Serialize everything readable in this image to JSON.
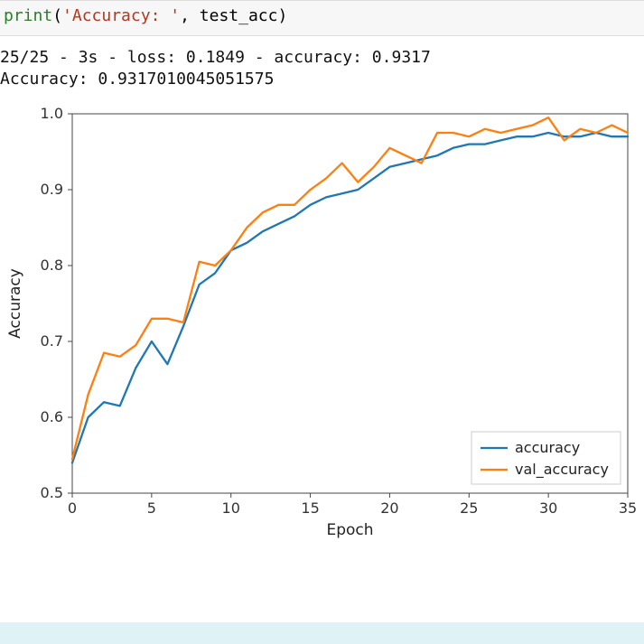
{
  "code": {
    "fn": "print",
    "lparen": "(",
    "str_lit": "'Accuracy: '",
    "comma_sp": ", ",
    "arg": "test_acc",
    "rparen": ")"
  },
  "output": {
    "line1": "25/25 - 3s - loss: 0.1849 - accuracy: 0.9317",
    "line2": "Accuracy:  0.9317010045051575"
  },
  "chart_data": {
    "type": "line",
    "xlabel": "Epoch",
    "ylabel": "Accuracy",
    "xlim": [
      0,
      35
    ],
    "ylim": [
      0.5,
      1.0
    ],
    "xticks": [
      0,
      5,
      10,
      15,
      20,
      25,
      30,
      35
    ],
    "yticks": [
      0.5,
      0.6,
      0.7,
      0.8,
      0.9,
      1.0
    ],
    "x": [
      0,
      1,
      2,
      3,
      4,
      5,
      6,
      7,
      8,
      9,
      10,
      11,
      12,
      13,
      14,
      15,
      16,
      17,
      18,
      19,
      20,
      21,
      22,
      23,
      24,
      25,
      26,
      27,
      28,
      29,
      30,
      31,
      32,
      33,
      34,
      35
    ],
    "series": [
      {
        "name": "accuracy",
        "color": "#1f77b4",
        "values": [
          0.54,
          0.6,
          0.62,
          0.615,
          0.665,
          0.7,
          0.67,
          0.72,
          0.775,
          0.79,
          0.82,
          0.83,
          0.845,
          0.855,
          0.865,
          0.88,
          0.89,
          0.895,
          0.9,
          0.915,
          0.93,
          0.935,
          0.94,
          0.945,
          0.955,
          0.96,
          0.96,
          0.965,
          0.97,
          0.97,
          0.975,
          0.97,
          0.97,
          0.975,
          0.97,
          0.97
        ]
      },
      {
        "name": "val_accuracy",
        "color": "#ff7f0e",
        "values": [
          0.545,
          0.63,
          0.685,
          0.68,
          0.695,
          0.73,
          0.73,
          0.725,
          0.805,
          0.8,
          0.82,
          0.85,
          0.87,
          0.88,
          0.88,
          0.9,
          0.915,
          0.935,
          0.91,
          0.93,
          0.955,
          0.945,
          0.935,
          0.975,
          0.975,
          0.97,
          0.98,
          0.975,
          0.98,
          0.985,
          0.995,
          0.965,
          0.98,
          0.975,
          0.985,
          0.975
        ]
      }
    ],
    "legend": {
      "position": "lower right",
      "labels": [
        "accuracy",
        "val_accuracy"
      ]
    }
  }
}
